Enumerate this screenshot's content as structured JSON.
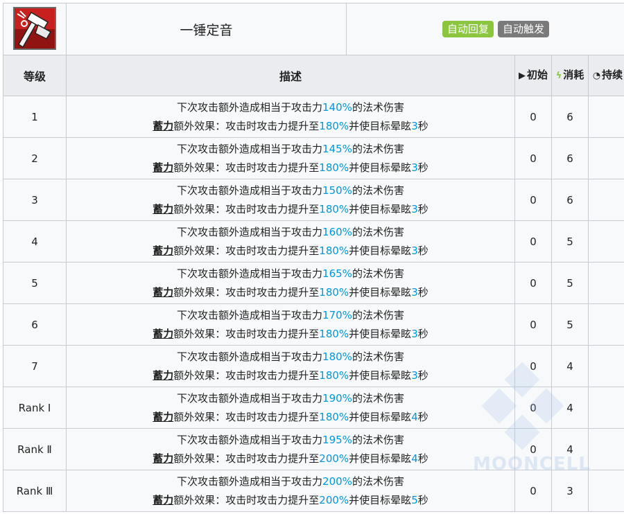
{
  "skill": {
    "name": "一锤定音",
    "icon": "hammer-skill-icon",
    "tags": [
      "自动回复",
      "自动触发"
    ]
  },
  "columns": {
    "level": "等级",
    "desc": "描述",
    "initial": "初始",
    "cost": "消耗",
    "duration": "持续"
  },
  "desc_parts": {
    "line1_pre": "下次攻击额外造成相当于攻击力",
    "line1_post": "的法术伤害",
    "keyword": "蓄力",
    "line2_mid": "额外效果：攻击时攻击力提升至",
    "line2_mid2": "并使目标晕眩",
    "line2_post": "秒"
  },
  "levels": [
    {
      "label": "1",
      "dmg": "140%",
      "atk": "180%",
      "stun": "3",
      "initial": "0",
      "cost": "6",
      "duration": ""
    },
    {
      "label": "2",
      "dmg": "145%",
      "atk": "180%",
      "stun": "3",
      "initial": "0",
      "cost": "6",
      "duration": ""
    },
    {
      "label": "3",
      "dmg": "150%",
      "atk": "180%",
      "stun": "3",
      "initial": "0",
      "cost": "6",
      "duration": ""
    },
    {
      "label": "4",
      "dmg": "160%",
      "atk": "180%",
      "stun": "3",
      "initial": "0",
      "cost": "5",
      "duration": ""
    },
    {
      "label": "5",
      "dmg": "165%",
      "atk": "180%",
      "stun": "3",
      "initial": "0",
      "cost": "5",
      "duration": ""
    },
    {
      "label": "6",
      "dmg": "170%",
      "atk": "180%",
      "stun": "3",
      "initial": "0",
      "cost": "5",
      "duration": ""
    },
    {
      "label": "7",
      "dmg": "180%",
      "atk": "180%",
      "stun": "3",
      "initial": "0",
      "cost": "4",
      "duration": ""
    },
    {
      "label": "Rank Ⅰ",
      "dmg": "190%",
      "atk": "180%",
      "stun": "4",
      "initial": "0",
      "cost": "4",
      "duration": ""
    },
    {
      "label": "Rank Ⅱ",
      "dmg": "195%",
      "atk": "200%",
      "stun": "4",
      "initial": "0",
      "cost": "4",
      "duration": ""
    },
    {
      "label": "Rank Ⅲ",
      "dmg": "200%",
      "atk": "200%",
      "stun": "5",
      "initial": "0",
      "cost": "3",
      "duration": ""
    }
  ],
  "watermark": "MOONCELL",
  "colors": {
    "highlight": "#0098dc",
    "tag_auto_recover": "#8cc63f",
    "tag_auto_trigger": "#7a7a7a"
  }
}
